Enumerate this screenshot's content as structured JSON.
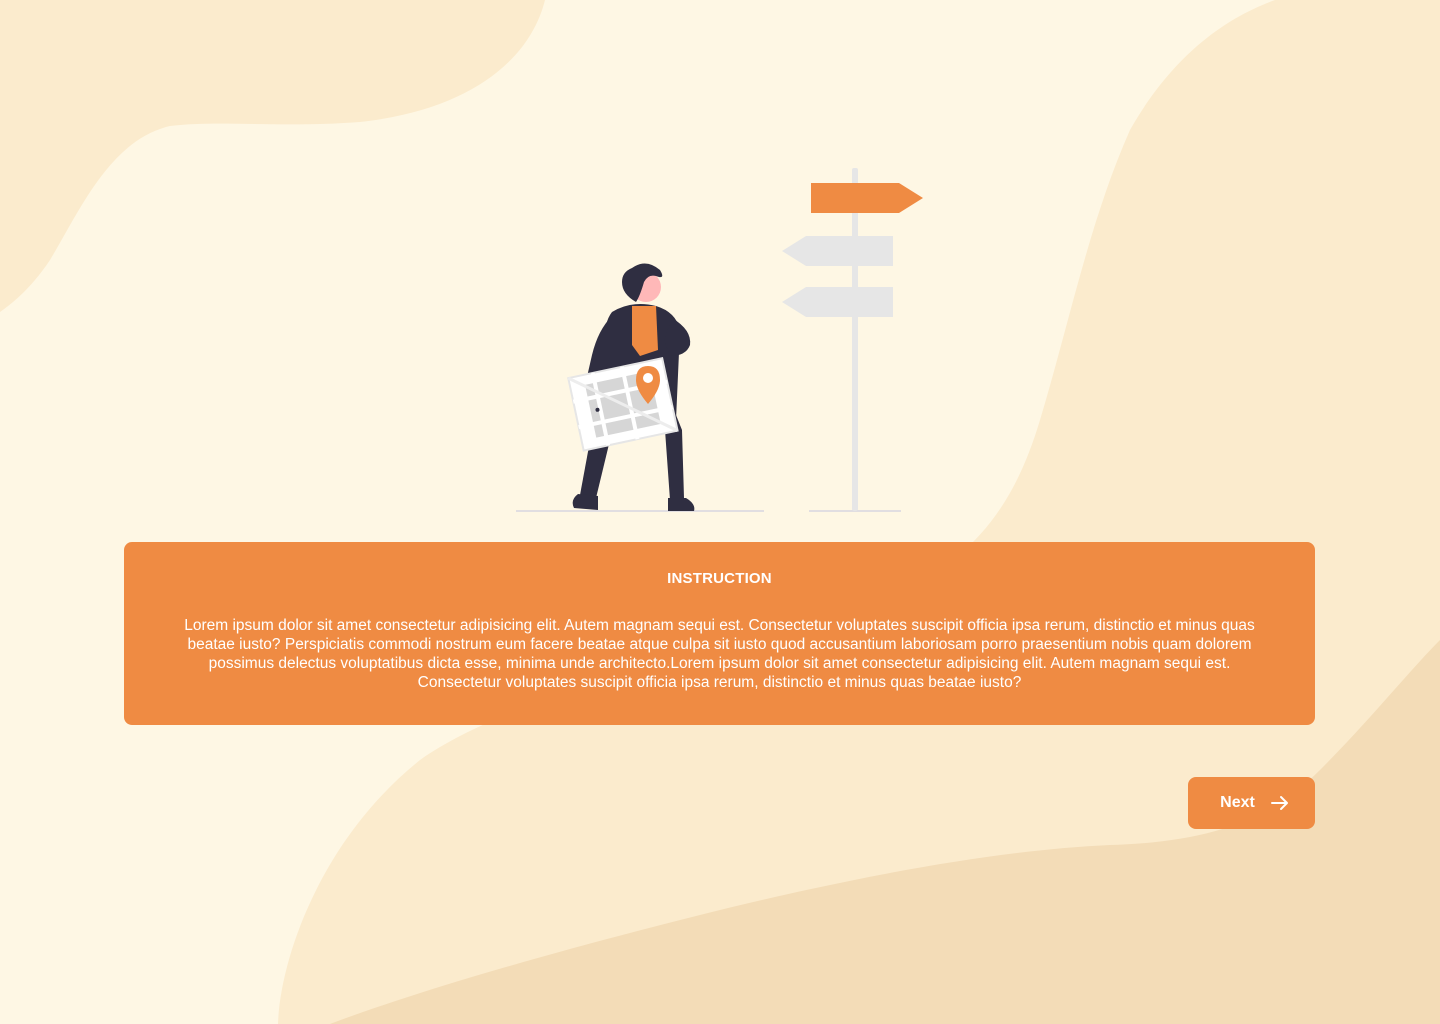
{
  "instruction": {
    "title": "INSTRUCTION",
    "body": "Lorem ipsum dolor sit amet consectetur adipisicing elit. Autem magnam sequi est. Consectetur voluptates suscipit officia ipsa rerum, distinctio et minus quas beatae iusto? Perspiciatis commodi nostrum eum facere beatae atque culpa sit iusto quod accusantium laboriosam porro praesentium nobis quam dolorem possimus delectus voluptatibus dicta esse, minima unde architecto.Lorem ipsum dolor sit amet consectetur adipisicing elit. Autem magnam sequi est. Consectetur voluptates suscipit officia ipsa rerum, distinctio et minus quas beatae iusto?"
  },
  "navigation": {
    "next_label": "Next",
    "next_icon": "arrow-right-icon"
  },
  "colors": {
    "background": "#FEF7E4",
    "blob_light": "#FBEBCD",
    "blob_dark": "#F3DCB7",
    "accent": "#EF8B43",
    "text_on_accent": "#FFFFFF"
  }
}
